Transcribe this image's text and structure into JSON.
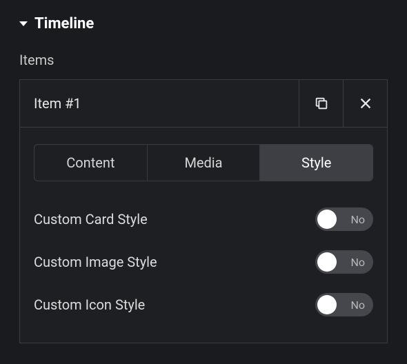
{
  "section": {
    "title": "Timeline",
    "expanded": true
  },
  "items_label": "Items",
  "item": {
    "title": "Item #1",
    "tabs": [
      {
        "label": "Content",
        "active": false
      },
      {
        "label": "Media",
        "active": false
      },
      {
        "label": "Style",
        "active": true
      }
    ],
    "toggles": [
      {
        "label": "Custom Card Style",
        "value": false,
        "text": "No"
      },
      {
        "label": "Custom Image Style",
        "value": false,
        "text": "No"
      },
      {
        "label": "Custom Icon Style",
        "value": false,
        "text": "No"
      }
    ]
  }
}
